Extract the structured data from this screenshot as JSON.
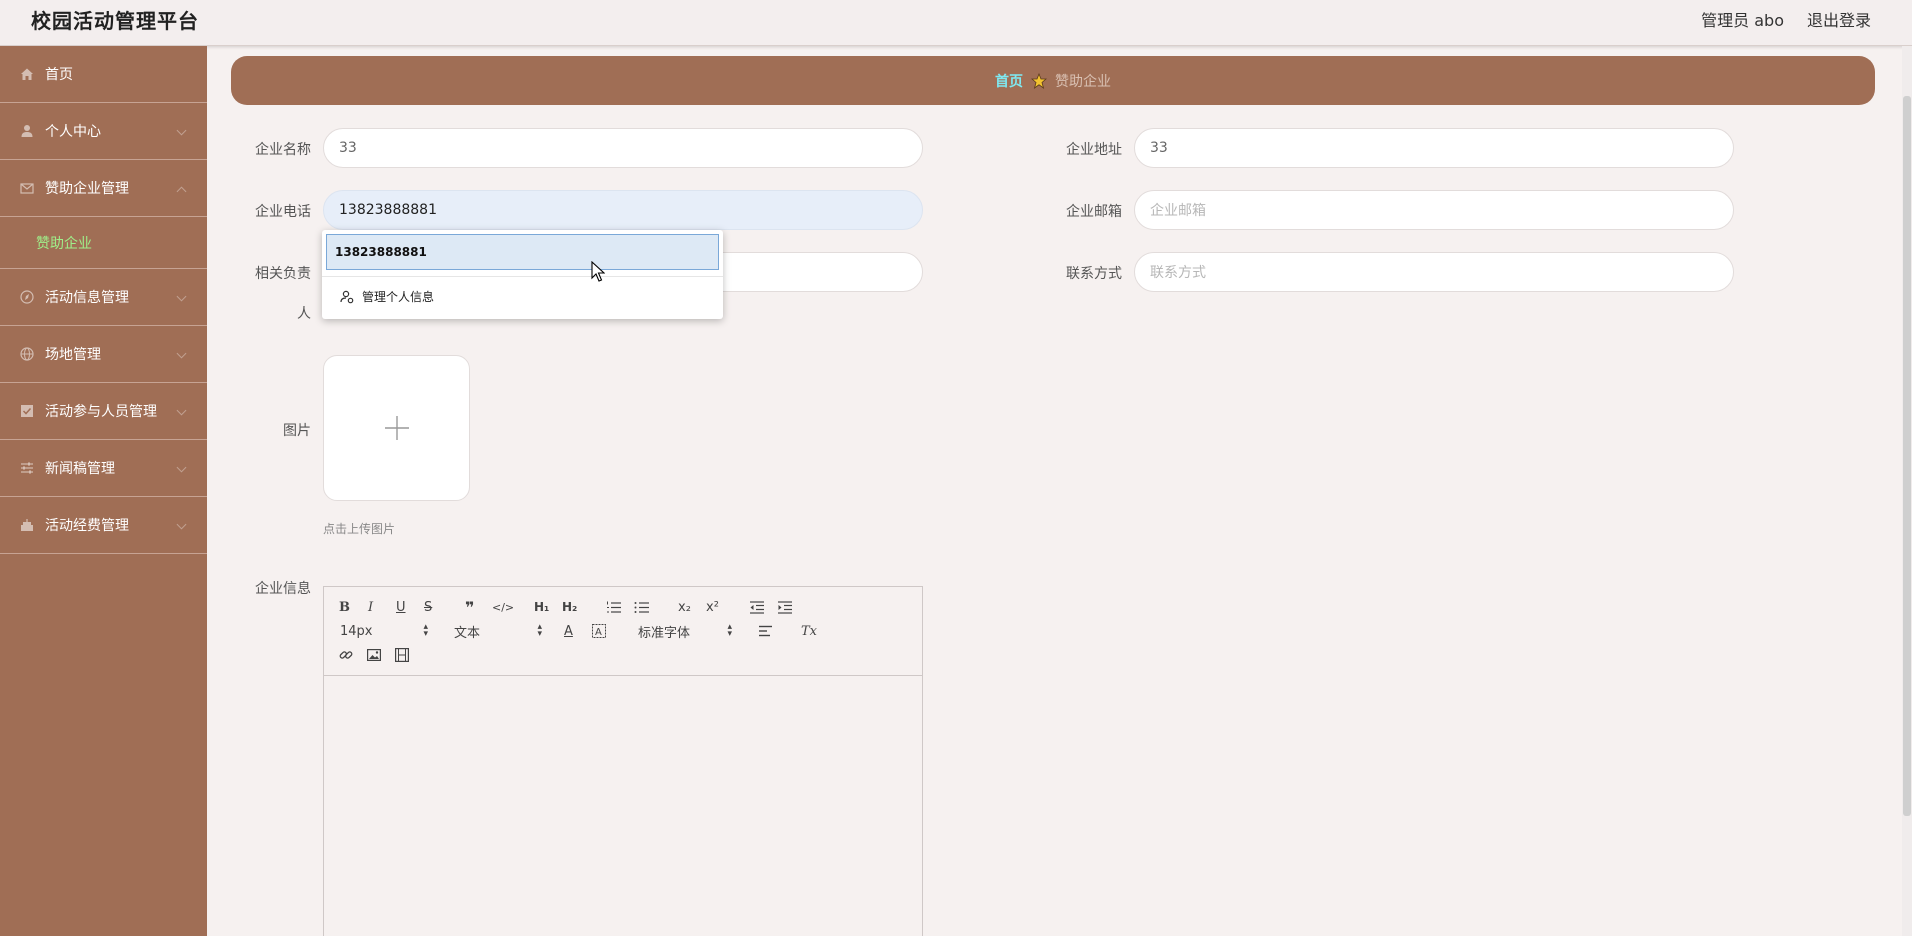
{
  "header": {
    "title": "校园活动管理平台",
    "user": "管理员 abo",
    "logout": "退出登录"
  },
  "sidebar": {
    "items": [
      {
        "label": "首页",
        "icon": "home-icon"
      },
      {
        "label": "个人中心",
        "icon": "user-icon"
      },
      {
        "label": "赞助企业管理",
        "icon": "mail-icon",
        "expanded": true
      },
      {
        "label": "活动信息管理",
        "icon": "compass-icon"
      },
      {
        "label": "场地管理",
        "icon": "globe-icon"
      },
      {
        "label": "活动参与人员管理",
        "icon": "checkbox-icon"
      },
      {
        "label": "新闻稿管理",
        "icon": "sliders-icon"
      },
      {
        "label": "活动经费管理",
        "icon": "cake-icon"
      }
    ],
    "active_sub": "赞助企业"
  },
  "breadcrumb": {
    "home": "首页",
    "current": "赞助企业"
  },
  "form": {
    "company_name": {
      "label": "企业名称",
      "value": "33"
    },
    "company_address": {
      "label": "企业地址",
      "value": "33"
    },
    "company_phone": {
      "label": "企业电话",
      "value": "13823888881"
    },
    "company_email": {
      "label": "企业邮箱",
      "placeholder": "企业邮箱"
    },
    "contact_person": {
      "label_line1": "相关负责",
      "label_line2": "人"
    },
    "contact_method": {
      "label": "联系方式",
      "placeholder": "联系方式"
    },
    "image": {
      "label": "图片",
      "tip": "点击上传图片"
    },
    "company_info": {
      "label": "企业信息"
    }
  },
  "autocomplete": {
    "option": "13823888881",
    "manage": "管理个人信息"
  },
  "editor": {
    "font_size": "14px",
    "block_type": "文本",
    "font_family": "标准字体"
  },
  "colors": {
    "sidebar": "#a06e55",
    "active_sub": "#9ff08a",
    "breadcrumb_home": "#7fe8f0"
  }
}
